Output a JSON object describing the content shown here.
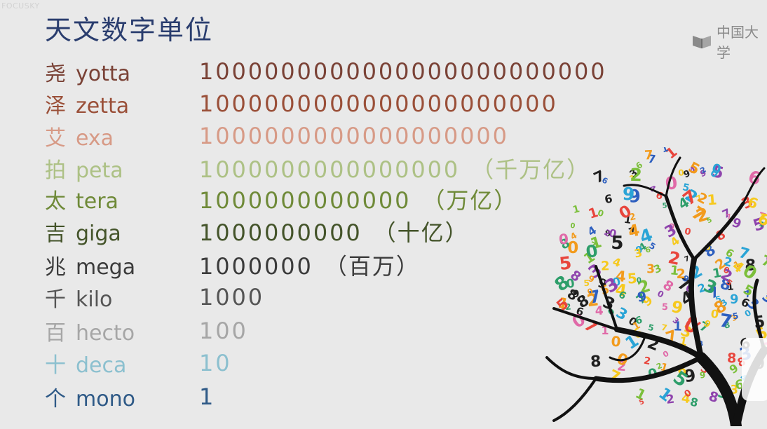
{
  "watermark": "FOCUSKY",
  "title": "天文数字单位",
  "brand": {
    "text": "中国大学",
    "icon": "book-logo-icon"
  },
  "units": [
    {
      "zh": "尧",
      "en": "yotta",
      "value": "1000000000000000000000000",
      "note": "",
      "color": "#7a4236"
    },
    {
      "zh": "泽",
      "en": "zetta",
      "value": "1000000000000000000000",
      "note": "",
      "color": "#9a4f38"
    },
    {
      "zh": "艾",
      "en": "exa",
      "value": "1000000000000000000",
      "note": "",
      "color": "#d79a86"
    },
    {
      "zh": "拍",
      "en": "peta",
      "value": "1000000000000000",
      "note": "（千万亿）",
      "color": "#adc185"
    },
    {
      "zh": "太",
      "en": "tera",
      "value": "1000000000000",
      "note": "（万亿）",
      "color": "#6f8a38"
    },
    {
      "zh": "吉",
      "en": "giga",
      "value": "1000000000",
      "note": "（十亿）",
      "color": "#44542a"
    },
    {
      "zh": "兆",
      "en": "mega",
      "value": "1000000",
      "note": "（百万）",
      "color": "#3b3b3b"
    },
    {
      "zh": "千",
      "en": "kilo",
      "value": "1000",
      "note": "",
      "color": "#555555"
    },
    {
      "zh": "百",
      "en": "hecto",
      "value": "100",
      "note": "",
      "color": "#a6a6a6"
    },
    {
      "zh": "十",
      "en": "deca",
      "value": "10",
      "note": "",
      "color": "#8cc0cf"
    },
    {
      "zh": "个",
      "en": "mono",
      "value": "1",
      "note": "",
      "color": "#2f5a87"
    }
  ],
  "decoration": {
    "tree_icon": "number-tree-icon",
    "digits": "0123456789"
  }
}
